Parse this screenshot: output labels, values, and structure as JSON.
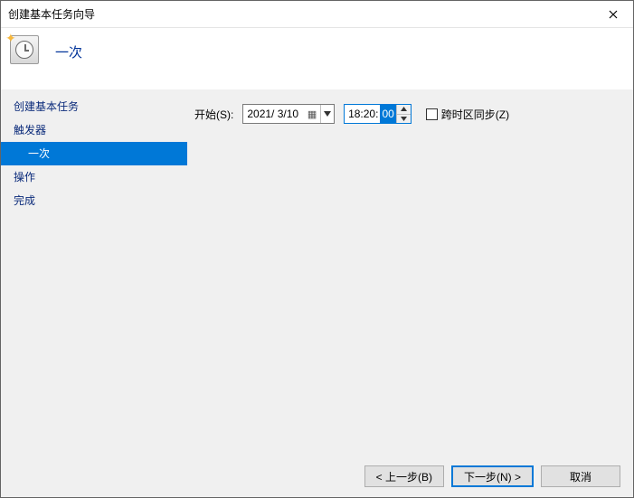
{
  "titlebar": {
    "title": "创建基本任务向导"
  },
  "header": {
    "page_title": "一次"
  },
  "sidebar": {
    "items": [
      {
        "label": "创建基本任务",
        "active": false,
        "indent": false
      },
      {
        "label": "触发器",
        "active": false,
        "indent": false
      },
      {
        "label": "一次",
        "active": true,
        "indent": true
      },
      {
        "label": "操作",
        "active": false,
        "indent": false
      },
      {
        "label": "完成",
        "active": false,
        "indent": false
      }
    ]
  },
  "content": {
    "start_label": "开始(S):",
    "date_value": "2021/ 3/10",
    "time_prefix": "18:20:",
    "time_selected": "00",
    "sync_checkbox_label": "跨时区同步(Z)",
    "sync_checked": false
  },
  "footer": {
    "back_label": "< 上一步(B)",
    "next_label": "下一步(N) >",
    "cancel_label": "取消"
  }
}
